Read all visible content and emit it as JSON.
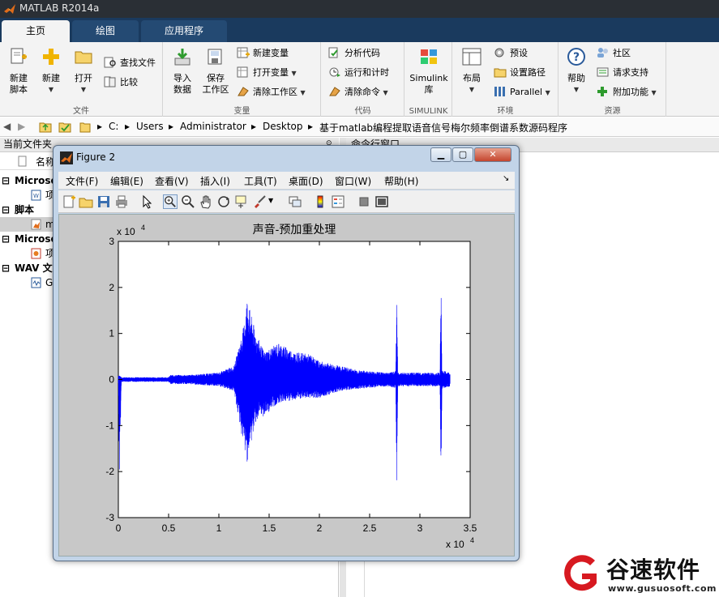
{
  "app": {
    "title": "MATLAB R2014a"
  },
  "tabs": [
    {
      "label": "主页"
    },
    {
      "label": "绘图"
    },
    {
      "label": "应用程序"
    }
  ],
  "ribbon": {
    "file": {
      "group_label": "文件",
      "new_script": "新建\n脚本",
      "new": "新建",
      "open": "打开",
      "find_files": "查找文件",
      "compare": "比较"
    },
    "variable": {
      "group_label": "变量",
      "import_data": "导入\n数据",
      "save_workspace": "保存\n工作区",
      "new_variable": "新建变量",
      "open_variable": "打开变量",
      "clear_workspace": "清除工作区"
    },
    "code": {
      "group_label": "代码",
      "analyze_code": "分析代码",
      "run_and_time": "运行和计时",
      "clear_commands": "清除命令"
    },
    "simulink": {
      "group_label": "SIMULINK",
      "simulink_lib": "Simulink\n库"
    },
    "environment": {
      "group_label": "环境",
      "layout": "布局",
      "preferences": "预设",
      "set_path": "设置路径",
      "parallel": "Parallel"
    },
    "resources": {
      "group_label": "资源",
      "help": "帮助",
      "community": "社区",
      "request_support": "请求支持",
      "add_ons": "附加功能"
    }
  },
  "address": {
    "parts": [
      "C:",
      "Users",
      "Administrator",
      "Desktop",
      "基于matlab编程提取语音信号梅尔频率倒谱系数源码程序"
    ]
  },
  "left_panel": {
    "title": "当前文件夹",
    "col_name": "名称",
    "rows": [
      {
        "label": "Microso",
        "bold": true
      },
      {
        "label": "项",
        "bold": false
      },
      {
        "label": "脚本",
        "bold": true
      },
      {
        "label": "m",
        "bold": false
      },
      {
        "label": "Microso",
        "bold": true
      },
      {
        "label": "项",
        "bold": false
      },
      {
        "label": "WAV 文",
        "bold": true
      },
      {
        "label": "G",
        "bold": false
      }
    ]
  },
  "right_panel": {
    "title": "命令行窗口"
  },
  "figure": {
    "window_title": "Figure 2",
    "menu": [
      "文件(F)",
      "编辑(E)",
      "查看(V)",
      "插入(I)",
      "工具(T)",
      "桌面(D)",
      "窗口(W)",
      "帮助(H)"
    ]
  },
  "chart_data": {
    "type": "line",
    "title": "声音-预加重处理",
    "xlabel": "",
    "ylabel": "",
    "x_exponent_label": "x 10",
    "x_exponent": "4",
    "y_exponent_label": "x 10",
    "y_exponent": "4",
    "xlim": [
      0,
      3.5
    ],
    "ylim": [
      -3,
      3
    ],
    "xticks": [
      0,
      0.5,
      1,
      1.5,
      2,
      2.5,
      3,
      3.5
    ],
    "xtick_labels": [
      "0",
      "0.5",
      "1",
      "1.5",
      "2",
      "2.5",
      "3",
      "3.5"
    ],
    "yticks": [
      -3,
      -2,
      -1,
      0,
      1,
      2,
      3
    ],
    "ytick_labels": [
      "-3",
      "-2",
      "-1",
      "0",
      "1",
      "2",
      "3"
    ],
    "series_color": "#0000ff",
    "series": [
      {
        "name": "",
        "envelope": [
          {
            "x": 0.0,
            "max": 0.1,
            "min": -0.1
          },
          {
            "x": 0.01,
            "max": 0.1,
            "min": -2.2
          },
          {
            "x": 0.03,
            "max": 0.05,
            "min": -0.05
          },
          {
            "x": 0.5,
            "max": 0.05,
            "min": -0.05
          },
          {
            "x": 0.52,
            "max": 0.1,
            "min": -0.1
          },
          {
            "x": 0.7,
            "max": 0.1,
            "min": -0.1
          },
          {
            "x": 1.0,
            "max": 0.15,
            "min": -0.15
          },
          {
            "x": 1.15,
            "max": 0.3,
            "min": -0.25
          },
          {
            "x": 1.2,
            "max": 0.7,
            "min": -0.9
          },
          {
            "x": 1.25,
            "max": 1.2,
            "min": -1.5
          },
          {
            "x": 1.28,
            "max": 1.8,
            "min": -1.8
          },
          {
            "x": 1.32,
            "max": 1.4,
            "min": -1.4
          },
          {
            "x": 1.37,
            "max": 1.0,
            "min": -0.9
          },
          {
            "x": 1.45,
            "max": 0.6,
            "min": -0.8
          },
          {
            "x": 1.6,
            "max": 0.8,
            "min": -0.5
          },
          {
            "x": 1.75,
            "max": 0.6,
            "min": -0.45
          },
          {
            "x": 1.9,
            "max": 0.55,
            "min": -0.4
          },
          {
            "x": 2.0,
            "max": 0.4,
            "min": -0.4
          },
          {
            "x": 2.2,
            "max": 0.3,
            "min": -0.25
          },
          {
            "x": 2.4,
            "max": 0.2,
            "min": -0.2
          },
          {
            "x": 2.7,
            "max": 0.15,
            "min": -0.15
          },
          {
            "x": 2.76,
            "max": 0.2,
            "min": -0.2
          },
          {
            "x": 2.77,
            "max": 2.1,
            "min": -2.5
          },
          {
            "x": 2.78,
            "max": 0.15,
            "min": -0.15
          },
          {
            "x": 3.2,
            "max": 0.15,
            "min": -0.15
          },
          {
            "x": 3.21,
            "max": 2.25,
            "min": -2.3
          },
          {
            "x": 3.22,
            "max": 0.2,
            "min": -0.2
          },
          {
            "x": 3.3,
            "max": 0.15,
            "min": -0.15
          }
        ]
      }
    ]
  },
  "watermark": {
    "brand": "谷速软件",
    "url": "www.gusuosoft.com",
    "color": "#d71920"
  }
}
